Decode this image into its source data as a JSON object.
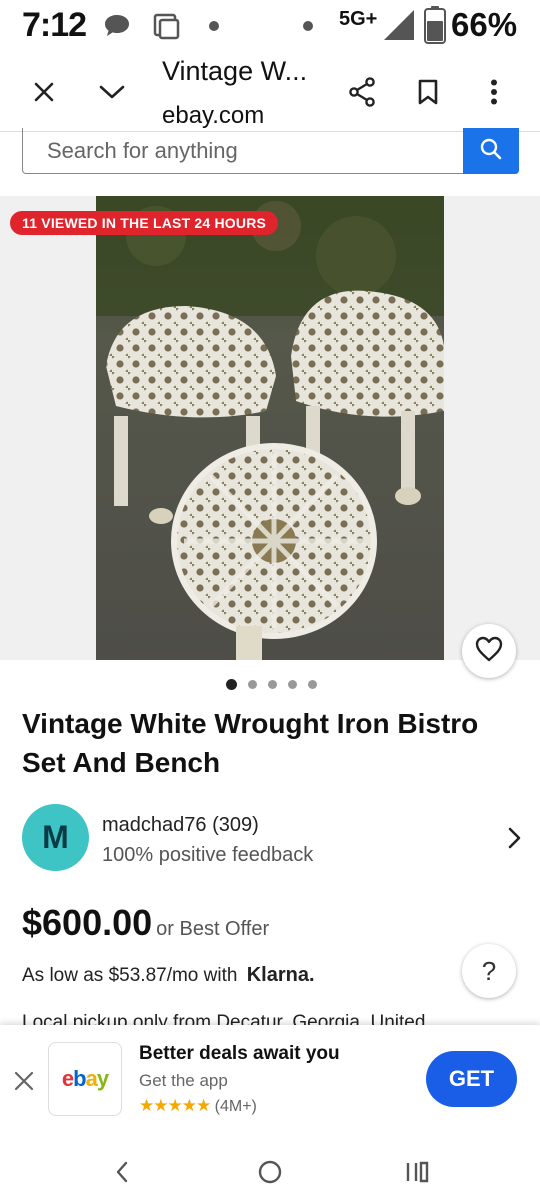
{
  "status_bar": {
    "time": "7:12",
    "network": "5G+",
    "battery": "66%",
    "icons": [
      "chat-icon",
      "screen-icon",
      "dot-icon",
      "dot-icon",
      "signal-icon",
      "battery-icon"
    ]
  },
  "browser": {
    "title": "Vintage W...",
    "domain": "ebay.com",
    "icons": [
      "close-icon",
      "chevron-down-icon",
      "share-icon",
      "bookmark-icon",
      "more-icon"
    ]
  },
  "search": {
    "placeholder": "Search for anything"
  },
  "gallery": {
    "badge": "11 VIEWED IN THE LAST 24 HOURS",
    "image_count": 5,
    "active_index": 0
  },
  "listing": {
    "title": "Vintage White Wrought Iron Bistro Set And Bench",
    "seller": {
      "initial": "M",
      "name": "madchad76 (309)",
      "feedback": "100% positive feedback"
    },
    "price": "$600.00",
    "offer": "or Best Offer",
    "financing": "As low as $53.87/mo with",
    "financing_brand": "Klarna.",
    "pickup": "Local pickup only from Decatur, Georgia, United"
  },
  "help": {
    "label": "?"
  },
  "app_banner": {
    "title": "Better deals await you",
    "subtitle": "Get the app",
    "stars": "★★★★★",
    "rating_count": "(4M+)",
    "cta": "GET",
    "logo_letters": [
      "e",
      "b",
      "a",
      "y"
    ]
  },
  "colors": {
    "ebay_blue": "#1a73e8",
    "badge_red": "#e0242c",
    "avatar_teal": "#3ec4c4",
    "logo_e": "#e53238",
    "logo_b": "#0064d2",
    "logo_a": "#f5af02",
    "logo_y": "#86b817"
  }
}
